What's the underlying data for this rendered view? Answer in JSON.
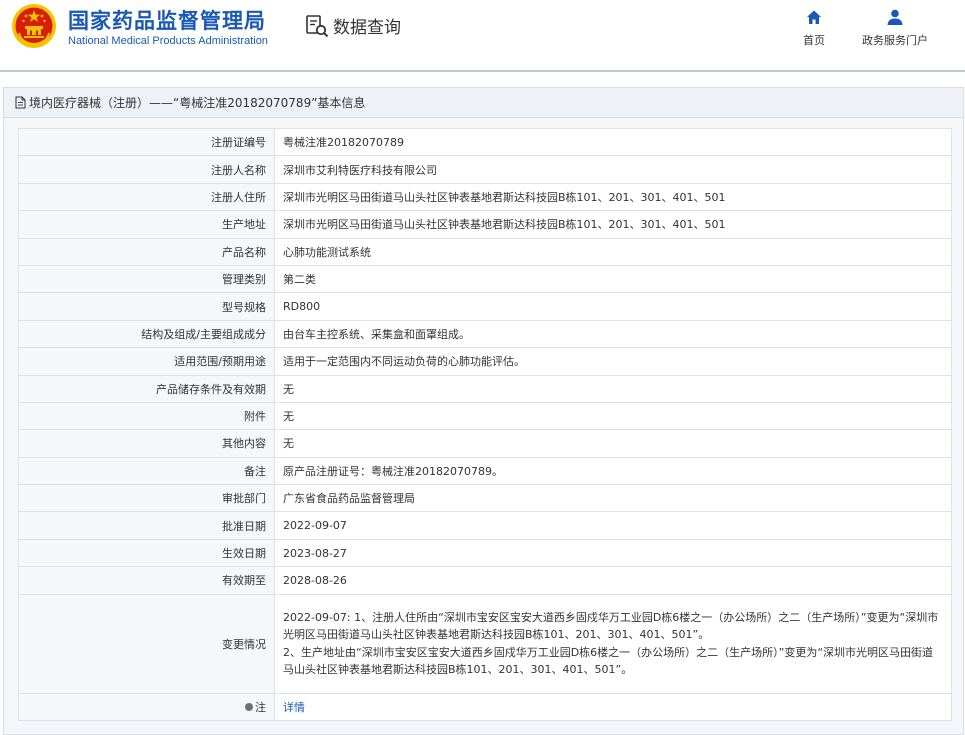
{
  "header": {
    "brand_cn": "国家药品监督管理局",
    "brand_en": "National Medical Products Administration",
    "search_title": "数据查询",
    "nav": [
      {
        "label": "首页",
        "icon": "home-icon"
      },
      {
        "label": "政务服务门户",
        "icon": "user-icon"
      }
    ]
  },
  "panel": {
    "title": "境内医疗器械（注册）——“粤械注准20182070789”基本信息"
  },
  "rows": [
    {
      "label": "注册证编号",
      "value": "粤械注准20182070789"
    },
    {
      "label": "注册人名称",
      "value": "深圳市艾利特医疗科技有限公司"
    },
    {
      "label": "注册人住所",
      "value": "深圳市光明区马田街道马山头社区钟表基地君斯达科技园B栋101、201、301、401、501"
    },
    {
      "label": "生产地址",
      "value": "深圳市光明区马田街道马山头社区钟表基地君斯达科技园B栋101、201、301、401、501"
    },
    {
      "label": "产品名称",
      "value": "心肺功能测试系统"
    },
    {
      "label": "管理类别",
      "value": "第二类"
    },
    {
      "label": "型号规格",
      "value": "RD800"
    },
    {
      "label": "结构及组成/主要组成成分",
      "value": "由台车主控系统、采集盒和面罩组成。"
    },
    {
      "label": "适用范围/预期用途",
      "value": "适用于一定范围内不同运动负荷的心肺功能评估。"
    },
    {
      "label": "产品储存条件及有效期",
      "value": "无"
    },
    {
      "label": "附件",
      "value": "无"
    },
    {
      "label": "其他内容",
      "value": "无"
    },
    {
      "label": "备注",
      "value": "原产品注册证号：粤械注准20182070789。"
    },
    {
      "label": "审批部门",
      "value": "广东省食品药品监督管理局"
    },
    {
      "label": "批准日期",
      "value": "2022-09-07"
    },
    {
      "label": "生效日期",
      "value": "2023-08-27"
    },
    {
      "label": "有效期至",
      "value": "2028-08-26"
    }
  ],
  "change": {
    "label": "变更情况",
    "value": "2022-09-07: 1、注册人住所由“深圳市宝安区宝安大道西乡固戍华万工业园D栋6楼之一（办公场所）之二（生产场所）”变更为“深圳市光明区马田街道马山头社区钟表基地君斯达科技园B栋101、201、301、401、501”。\n2、生产地址由“深圳市宝安区宝安大道西乡固戍华万工业园D栋6楼之一（办公场所）之二（生产场所）”变更为“深圳市光明区马田街道马山头社区钟表基地君斯达科技园B栋101、201、301、401、501”。"
  },
  "note": {
    "label": "注",
    "link": "详情"
  },
  "colors": {
    "brand_blue": "#1a59b3",
    "emblem_red": "#d81e06",
    "emblem_gold": "#f5c400"
  }
}
